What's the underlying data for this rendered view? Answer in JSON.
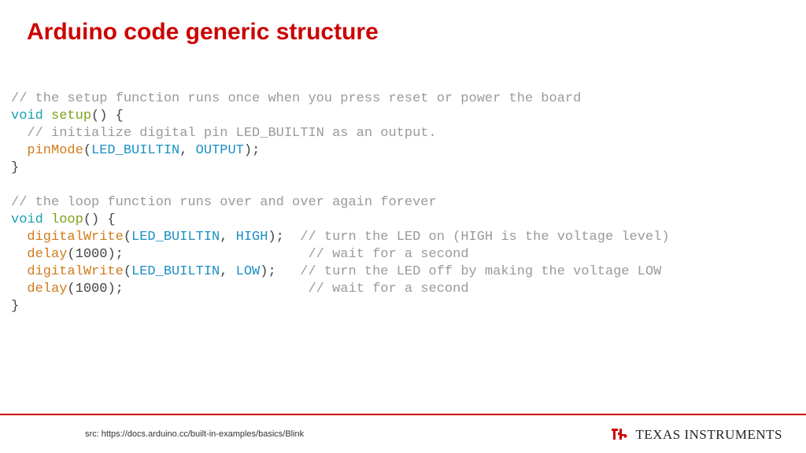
{
  "title": "Arduino code generic structure",
  "code": {
    "l1": "// the setup function runs once when you press reset or power the board",
    "l2a": "void",
    "l2b": "setup",
    "l2c": "() {",
    "l3": "  // initialize digital pin LED_BUILTIN as an output.",
    "l4a": "pinMode",
    "l4b": "LED_BUILTIN",
    "l4c": "OUTPUT",
    "l5": "}",
    "l7": "// the loop function runs over and over again forever",
    "l8a": "void",
    "l8b": "loop",
    "l8c": "() {",
    "l9a": "digitalWrite",
    "l9b": "LED_BUILTIN",
    "l9c": "HIGH",
    "l9d": "// turn the LED on (HIGH is the voltage level)",
    "l10a": "delay",
    "l10b": "1000",
    "l10c": "// wait for a second",
    "l11a": "digitalWrite",
    "l11b": "LED_BUILTIN",
    "l11c": "LOW",
    "l11d": "// turn the LED off by making the voltage LOW",
    "l12a": "delay",
    "l12b": "1000",
    "l12c": "// wait for a second",
    "l13": "}"
  },
  "footer": {
    "src": "src: https://docs.arduino.cc/built-in-examples/basics/Blink",
    "logo_text": "TEXAS INSTRUMENTS"
  }
}
